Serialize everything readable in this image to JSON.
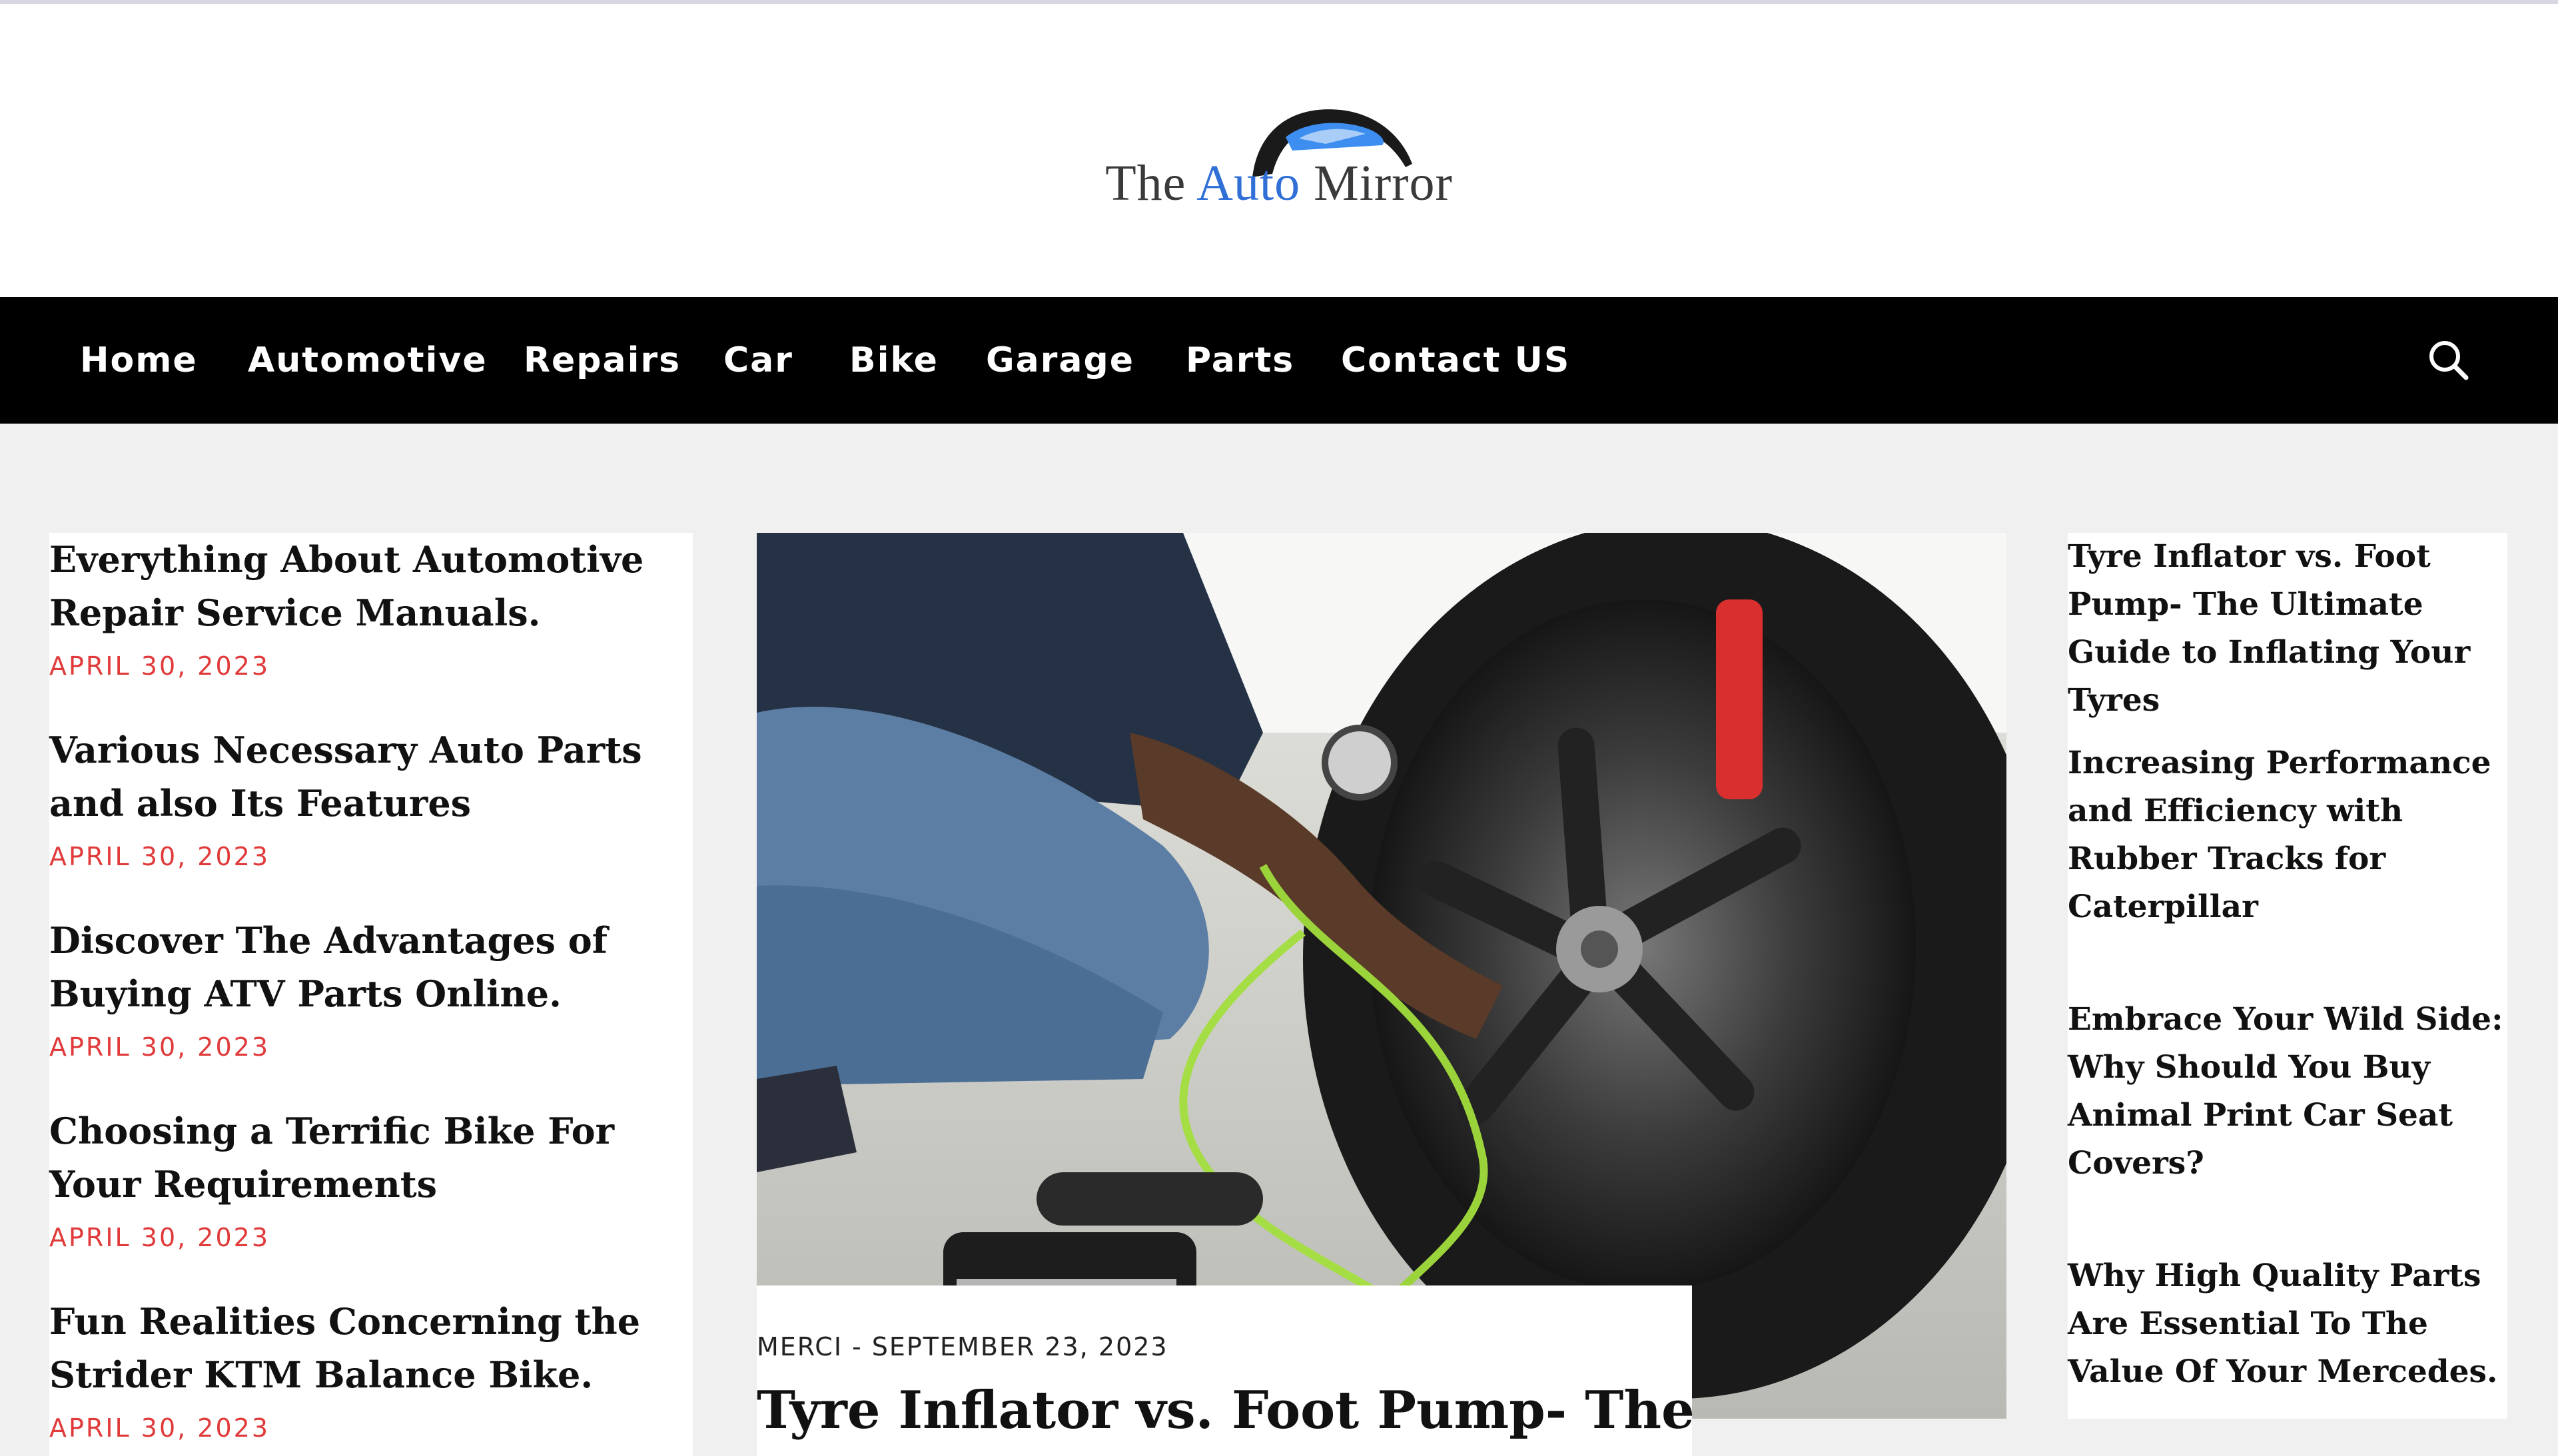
{
  "logo": {
    "text_the": "The ",
    "text_auto": "Auto",
    "text_mirror": " Mirror"
  },
  "nav": {
    "items": [
      "Home",
      "Automotive",
      "Repairs",
      "Car",
      "Bike",
      "Garage",
      "Parts",
      "Contact US"
    ],
    "search_icon": "search-icon"
  },
  "left_posts": [
    {
      "title": "Everything About Automotive Repair Service Manuals.",
      "date": "APRIL 30, 2023"
    },
    {
      "title": "Various Necessary Auto Parts and also Its Features",
      "date": "APRIL 30, 2023"
    },
    {
      "title": "Discover The Advantages of Buying ATV Parts Online.",
      "date": "APRIL 30, 2023"
    },
    {
      "title": "Choosing a Terrific Bike For Your Requirements",
      "date": "APRIL 30, 2023"
    },
    {
      "title": "Fun Realities Concerning the Strider KTM Balance Bike.",
      "date": "APRIL 30, 2023"
    }
  ],
  "featured": {
    "author": "MERCI",
    "separator": "-",
    "date": "SEPTEMBER 23, 2023",
    "title": "Tyre Inflator vs. Foot Pump- The"
  },
  "right_posts": [
    "Tyre Inflator vs. Foot Pump- The Ultimate Guide to Inflating Your Tyres",
    "Increasing Performance and Efficiency with Rubber Tracks for Caterpillar",
    "Embrace Your Wild Side: Why Should You Buy Animal Print Car Seat Covers?",
    "Why High Quality Parts Are Essential To The Value Of Your Mercedes."
  ],
  "colors": {
    "nav_bg": "#000000",
    "accent_date": "#e03a3a",
    "logo_blue": "#2f6fd6"
  }
}
